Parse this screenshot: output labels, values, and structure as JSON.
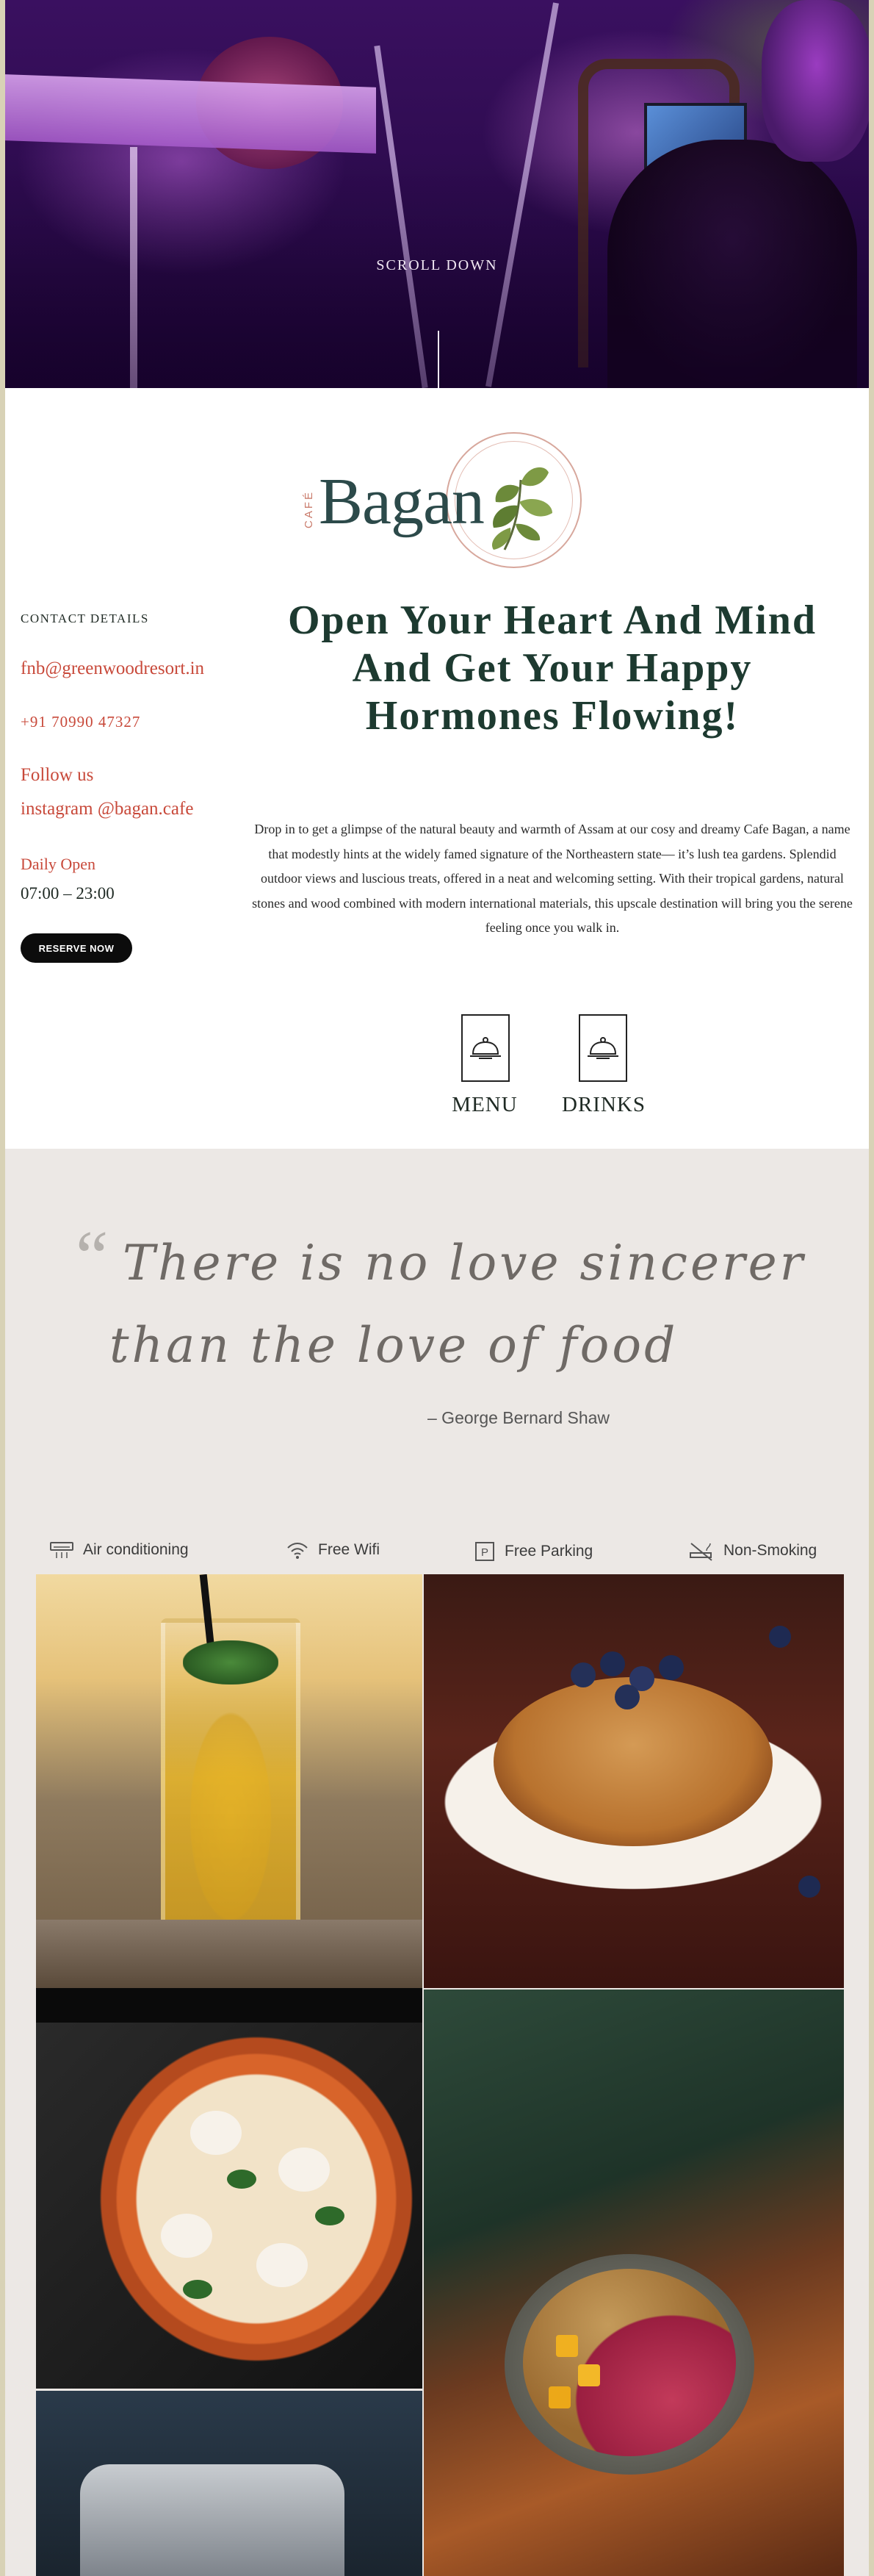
{
  "hero": {
    "scroll_label": "SCROLL DOWN"
  },
  "logo": {
    "small": "CAFÉ",
    "name": "Bagan"
  },
  "contact": {
    "heading": "CONTACT DETAILS",
    "email": "fnb@greenwoodresort.in",
    "phone": "+91 70990 47327",
    "follow_label": "Follow us",
    "instagram": "instagram @bagan.cafe",
    "hours_label": "Daily Open",
    "hours": "07:00 – 23:00",
    "reserve_button": "RESERVE NOW"
  },
  "main": {
    "headline": "Open Your Heart And Mind And Get Your Happy Hormones Flowing!",
    "intro": "Drop in to get a glimpse of the natural beauty and warmth of Assam at our cosy and dreamy Cafe Bagan, a name that modestly hints at the widely famed signature of the Northeastern state— it’s lush tea gardens. Splendid outdoor views and luscious treats, offered in a neat and welcoming setting. With their tropical gardens, natural stones and wood combined with modern international materials, this upscale destination will bring you the serene feeling once you walk in.",
    "menu_label": "MENU",
    "drinks_label": "DRINKS"
  },
  "quote": {
    "mark": "“",
    "line1": "There is no love sincerer",
    "line2": "than the love of food",
    "author": "– George Bernard Shaw"
  },
  "amenities": [
    {
      "icon": "air-conditioner-icon",
      "label": "Air conditioning"
    },
    {
      "icon": "wifi-icon",
      "label": "Free Wifi"
    },
    {
      "icon": "parking-icon",
      "label": "Free Parking"
    },
    {
      "icon": "no-smoking-icon",
      "label": "Non-Smoking"
    }
  ],
  "colors": {
    "accent": "#c8493a",
    "heading": "#1d3a30",
    "quote_bg": "#ece8e5",
    "frame": "#d8d2b6"
  }
}
